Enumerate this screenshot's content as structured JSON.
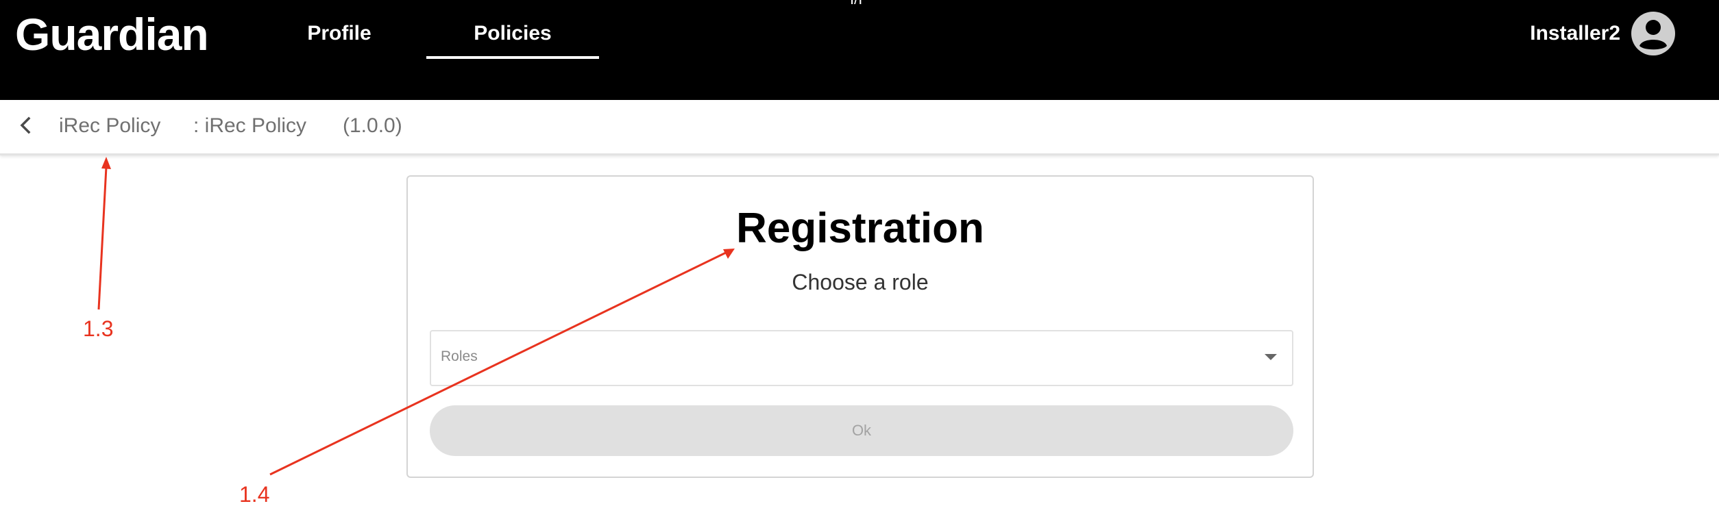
{
  "header": {
    "logo": "Guardian",
    "top_marker": "I/I",
    "nav": [
      {
        "label": "Profile",
        "active": false
      },
      {
        "label": "Policies",
        "active": true
      }
    ],
    "username": "Installer2",
    "avatar_icon": "account-circle-icon"
  },
  "breadcrumb": {
    "back_icon": "chevron-left-icon",
    "policy_name": "iRec Policy",
    "policy_subtitle": ": iRec Policy",
    "version": "(1.0.0)"
  },
  "registration": {
    "title": "Registration",
    "subtitle": "Choose a role",
    "roles_select": {
      "label": "Roles",
      "value": "",
      "arrow_icon": "caret-down-icon"
    },
    "ok_button": {
      "label": "Ok",
      "disabled": true
    }
  },
  "annotations": [
    {
      "label": "1.3",
      "color": "#e8331f"
    },
    {
      "label": "1.4",
      "color": "#e8331f"
    }
  ],
  "colors": {
    "header_bg": "#000000",
    "content_bg": "#ffffff",
    "annotation": "#e8331f",
    "disabled_button": "#e0e0e0"
  }
}
